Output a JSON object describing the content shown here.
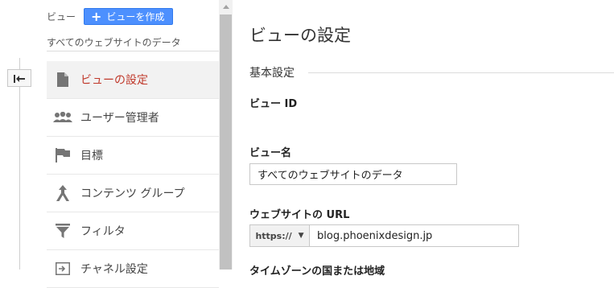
{
  "sidebar": {
    "header_label": "ビュー",
    "create_button_label": "ビューを作成",
    "subtitle": "すべてのウェブサイトのデータ",
    "items": [
      {
        "label": "ビューの設定",
        "icon": "document-icon",
        "active": true
      },
      {
        "label": "ユーザー管理者",
        "icon": "users-icon",
        "active": false
      },
      {
        "label": "目標",
        "icon": "flag-icon",
        "active": false
      },
      {
        "label": "コンテンツ グループ",
        "icon": "content-group-icon",
        "active": false
      },
      {
        "label": "フィルタ",
        "icon": "filter-icon",
        "active": false
      },
      {
        "label": "チャネル設定",
        "icon": "channel-icon",
        "active": false
      }
    ]
  },
  "main": {
    "title": "ビューの設定",
    "section_title": "基本設定",
    "view_id_label": "ビュー ID",
    "view_name_label": "ビュー名",
    "view_name_value": "すべてのウェブサイトのデータ",
    "url_label": "ウェブサイトの URL",
    "protocol": "https://",
    "url_value": "blog.phoenixdesign.jp",
    "next_label": "タイムゾーンの国または地域"
  },
  "colors": {
    "accent": "#4d90fe",
    "active_text": "#c0392b",
    "active_bg": "#f2f2f2"
  }
}
